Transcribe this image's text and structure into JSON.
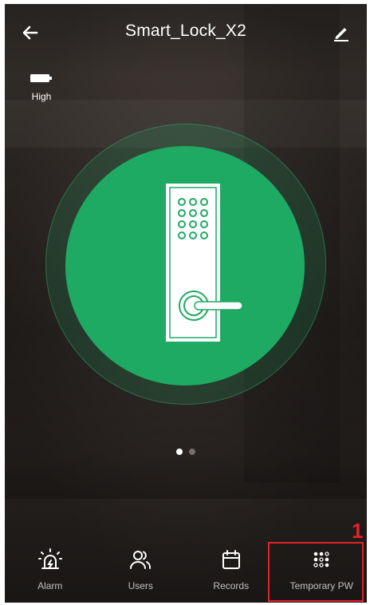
{
  "header": {
    "title": "Smart_Lock_X2",
    "back_icon": "arrow-left-icon",
    "edit_icon": "pencil-icon"
  },
  "battery": {
    "icon": "battery-icon",
    "level_label": "High"
  },
  "lock": {
    "icon": "door-lock-keypad-icon",
    "accent_color": "#1faa63"
  },
  "pager": {
    "count": 2,
    "active_index": 0
  },
  "nav": {
    "items": [
      {
        "label": "Alarm",
        "icon": "alarm-siren-icon"
      },
      {
        "label": "Users",
        "icon": "users-icon"
      },
      {
        "label": "Records",
        "icon": "calendar-icon"
      },
      {
        "label": "Temporary PW",
        "icon": "keypad-icon"
      }
    ]
  },
  "annotation": {
    "marker": "1",
    "color": "#e3222a"
  }
}
